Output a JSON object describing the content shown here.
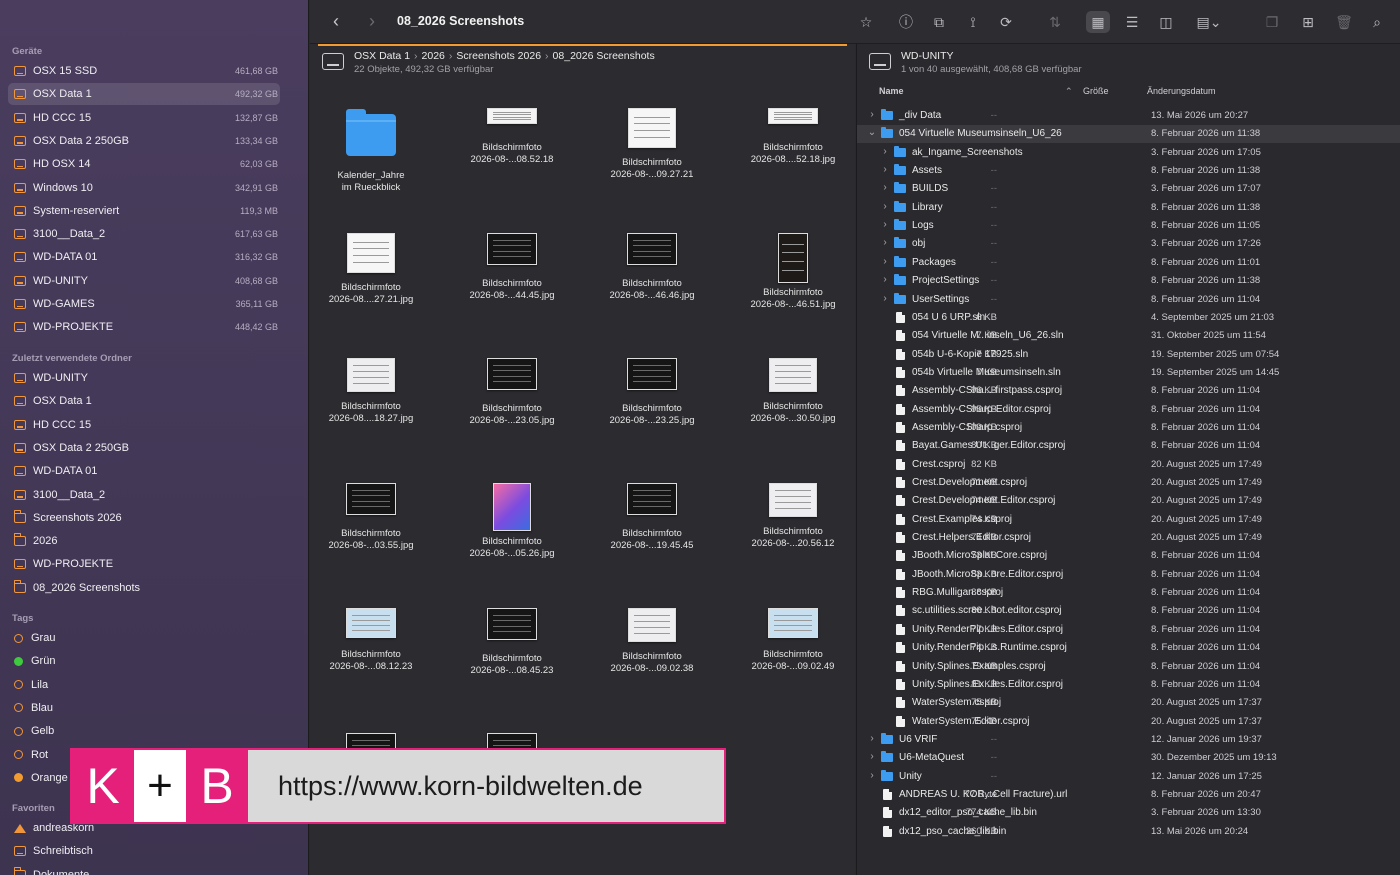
{
  "sidebar": {
    "devices_heading": "Geräte",
    "devices": [
      {
        "label": "OSX 15 SSD",
        "size": "461,68 GB"
      },
      {
        "label": "OSX Data 1",
        "size": "492,32 GB",
        "selected": true
      },
      {
        "label": "HD CCC 15",
        "size": "132,87 GB"
      },
      {
        "label": "OSX Data 2 250GB",
        "size": "133,34 GB"
      },
      {
        "label": "HD OSX 14",
        "size": "62,03 GB"
      },
      {
        "label": "Windows 10",
        "size": "342,91 GB"
      },
      {
        "label": "System-reserviert",
        "size": "119,3 MB"
      },
      {
        "label": "3100__Data_2",
        "size": "617,63 GB"
      },
      {
        "label": "WD-DATA 01",
        "size": "316,32 GB"
      },
      {
        "label": "WD-UNITY",
        "size": "408,68 GB"
      },
      {
        "label": "WD-GAMES",
        "size": "365,11 GB"
      },
      {
        "label": "WD-PROJEKTE",
        "size": "448,42 GB"
      }
    ],
    "recent_heading": "Zuletzt verwendete Ordner",
    "recent": [
      {
        "label": "WD-UNITY",
        "icon": "drive-icon"
      },
      {
        "label": "OSX Data 1",
        "icon": "drive-icon"
      },
      {
        "label": "HD CCC 15",
        "icon": "drive-icon"
      },
      {
        "label": "OSX Data 2 250GB",
        "icon": "drive-icon"
      },
      {
        "label": "WD-DATA 01",
        "icon": "drive-icon"
      },
      {
        "label": "3100__Data_2",
        "icon": "drive-icon"
      },
      {
        "label": "Screenshots 2026",
        "icon": "folder-icon"
      },
      {
        "label": "2026",
        "icon": "folder-icon"
      },
      {
        "label": "WD-PROJEKTE",
        "icon": "drive-icon"
      },
      {
        "label": "08_2026 Screenshots",
        "icon": "folder-icon"
      }
    ],
    "tags_heading": "Tags",
    "tags": [
      {
        "label": "Grau",
        "color": "empty"
      },
      {
        "label": "Grün",
        "color": "green"
      },
      {
        "label": "Lila",
        "color": "empty"
      },
      {
        "label": "Blau",
        "color": "empty"
      },
      {
        "label": "Gelb",
        "color": "empty"
      },
      {
        "label": "Rot",
        "color": "empty"
      },
      {
        "label": "Orange",
        "color": "orange"
      }
    ],
    "favorites_heading": "Favoriten",
    "favorites": [
      {
        "label": "andreaskorn",
        "icon": "home-icon"
      },
      {
        "label": "Schreibtisch",
        "icon": "drive-icon"
      },
      {
        "label": "Dokumente",
        "icon": "folder-icon"
      }
    ]
  },
  "toolbar": {
    "back": "‹",
    "forward": "›",
    "title": "08_2026 Screenshots",
    "icons": [
      {
        "name": "favorite-star-icon",
        "glyph": "☆",
        "on": false
      },
      {
        "name": "info-icon",
        "glyph": "ⓘ",
        "on": false
      },
      {
        "name": "group-icon",
        "glyph": "⧉",
        "on": false
      },
      {
        "name": "share-link-icon",
        "glyph": "⟟",
        "on": false
      },
      {
        "name": "sync-icon",
        "glyph": "⟳",
        "on": false
      },
      {
        "name": "swap-panes-icon",
        "glyph": "⇅",
        "on": false,
        "dim": true
      },
      {
        "name": "grid-view-icon",
        "glyph": "▦",
        "on": true
      },
      {
        "name": "list-view-icon",
        "glyph": "☰",
        "on": false
      },
      {
        "name": "column-view-icon",
        "glyph": "◫",
        "on": false
      },
      {
        "name": "gallery-view-icon",
        "glyph": "▤⌄",
        "on": false
      },
      {
        "name": "copy-icon",
        "glyph": "❐",
        "on": false,
        "dim": true
      },
      {
        "name": "new-folder-icon",
        "glyph": "⊞",
        "on": false
      },
      {
        "name": "trash-icon",
        "glyph": "🗑",
        "on": false,
        "dim": true
      },
      {
        "name": "search-icon",
        "glyph": "⌕",
        "on": false
      }
    ]
  },
  "left": {
    "path": [
      "OSX Data 1",
      "2026",
      "Screenshots 2026",
      "08_2026 Screenshots"
    ],
    "path_sep": "›",
    "status": "22 Objekte, 492,32 GB verfügbar",
    "items": [
      {
        "l1": "Kalender_Jahre",
        "l2": "im Rueckblick",
        "kind": "folder"
      },
      {
        "l1": "Bildschirmfoto",
        "l2": "2026-08-...08.52.18",
        "kind": "wide"
      },
      {
        "l1": "Bildschirmfoto",
        "l2": "2026-08-...09.27.21",
        "kind": "doc"
      },
      {
        "l1": "Bildschirmfoto",
        "l2": "2026-08....52.18.jpg",
        "kind": "wide"
      },
      {
        "l1": "Bildschirmfoto",
        "l2": "2026-08....27.21.jpg",
        "kind": "doc"
      },
      {
        "l1": "Bildschirmfoto",
        "l2": "2026-08-...44.45.jpg",
        "kind": "dark"
      },
      {
        "l1": "Bildschirmfoto",
        "l2": "2026-08-...46.46.jpg",
        "kind": "dark"
      },
      {
        "l1": "Bildschirmfoto",
        "l2": "2026-08-...46.51.jpg",
        "kind": "tall"
      },
      {
        "l1": "Bildschirmfoto",
        "l2": "2026-08....18.27.jpg",
        "kind": "light"
      },
      {
        "l1": "Bildschirmfoto",
        "l2": "2026-08-...23.05.jpg",
        "kind": "dark"
      },
      {
        "l1": "Bildschirmfoto",
        "l2": "2026-08-...23.25.jpg",
        "kind": "dark"
      },
      {
        "l1": "Bildschirmfoto",
        "l2": "2026-08-...30.50.jpg",
        "kind": "light"
      },
      {
        "l1": "Bildschirmfoto",
        "l2": "2026-08-...03.55.jpg",
        "kind": "dark"
      },
      {
        "l1": "Bildschirmfoto",
        "l2": "2026-08-...05.26.jpg",
        "kind": "grad"
      },
      {
        "l1": "Bildschirmfoto",
        "l2": "2026-08-...19.45.45",
        "kind": "dark"
      },
      {
        "l1": "Bildschirmfoto",
        "l2": "2026-08-...20.56.12",
        "kind": "light"
      },
      {
        "l1": "Bildschirmfoto",
        "l2": "2026-08-...08.12.23",
        "kind": "blue"
      },
      {
        "l1": "Bildschirmfoto",
        "l2": "2026-08-...08.45.23",
        "kind": "dark"
      },
      {
        "l1": "Bildschirmfoto",
        "l2": "2026-08-...09.02.38",
        "kind": "light"
      },
      {
        "l1": "Bildschirmfoto",
        "l2": "2026-08-...09.02.49",
        "kind": "blue"
      },
      {
        "l1": "",
        "l2": "",
        "kind": "dark"
      },
      {
        "l1": "",
        "l2": "",
        "kind": "dark"
      }
    ]
  },
  "right": {
    "title": "WD-UNITY",
    "status": "1 von 40 ausgewählt, 408,68 GB verfügbar",
    "col_name": "Name",
    "col_size": "Größe",
    "col_date": "Änderungsdatum",
    "rows": [
      {
        "depth": 0,
        "chev": "›",
        "icon": "folder",
        "name": "_div Data",
        "size": "--",
        "date": "13. Mai 2026 um 20:27"
      },
      {
        "depth": 0,
        "chev": "⌄",
        "icon": "folder",
        "name": "054 Virtuelle Museumsinseln_U6_26",
        "size": "--",
        "date": "8. Februar 2026 um 11:38",
        "selected": true
      },
      {
        "depth": 1,
        "chev": "›",
        "icon": "folder",
        "name": "ak_Ingame_Screenshots",
        "size": "--",
        "date": "3. Februar 2026 um 17:05"
      },
      {
        "depth": 1,
        "chev": "›",
        "icon": "folder",
        "name": "Assets",
        "size": "--",
        "date": "8. Februar 2026 um 11:38"
      },
      {
        "depth": 1,
        "chev": "›",
        "icon": "folder",
        "name": "BUILDS",
        "size": "--",
        "date": "3. Februar 2026 um 17:07"
      },
      {
        "depth": 1,
        "chev": "›",
        "icon": "folder",
        "name": "Library",
        "size": "--",
        "date": "8. Februar 2026 um 11:38"
      },
      {
        "depth": 1,
        "chev": "›",
        "icon": "folder",
        "name": "Logs",
        "size": "--",
        "date": "8. Februar 2026 um 11:05"
      },
      {
        "depth": 1,
        "chev": "›",
        "icon": "folder",
        "name": "obj",
        "size": "--",
        "date": "3. Februar 2026 um 17:26"
      },
      {
        "depth": 1,
        "chev": "›",
        "icon": "folder",
        "name": "Packages",
        "size": "--",
        "date": "8. Februar 2026 um 11:01"
      },
      {
        "depth": 1,
        "chev": "›",
        "icon": "folder",
        "name": "ProjectSettings",
        "size": "--",
        "date": "8. Februar 2026 um 11:38"
      },
      {
        "depth": 1,
        "chev": "›",
        "icon": "folder",
        "name": "UserSettings",
        "size": "--",
        "date": "8. Februar 2026 um 11:04"
      },
      {
        "depth": 1,
        "chev": "",
        "icon": "file",
        "name": "054 U 6 URP.sln",
        "size": "6 KB",
        "date": "4. September 2025 um 21:03"
      },
      {
        "depth": 1,
        "chev": "",
        "icon": "file",
        "name": "054 Virtuelle M...inseln_U6_26.sln",
        "size": "7 KB",
        "date": "31. Oktober 2025 um 11:54"
      },
      {
        "depth": 1,
        "chev": "",
        "icon": "file",
        "name": "054b U-6-Kopie 17925.sln",
        "size": "7 KB",
        "date": "19. September 2025 um 07:54"
      },
      {
        "depth": 1,
        "chev": "",
        "icon": "file",
        "name": "054b Virtuelle Museumsinseln.sln",
        "size": "7 KB",
        "date": "19. September 2025 um 14:45"
      },
      {
        "depth": 1,
        "chev": "",
        "icon": "file",
        "name": "Assembly-CSha...-firstpass.csproj",
        "size": "96 KB",
        "date": "8. Februar 2026 um 11:04"
      },
      {
        "depth": 1,
        "chev": "",
        "icon": "file",
        "name": "Assembly-CSharp-Editor.csproj",
        "size": "95 KB",
        "date": "8. Februar 2026 um 11:04"
      },
      {
        "depth": 1,
        "chev": "",
        "icon": "file",
        "name": "Assembly-CSharp.csproj",
        "size": "109 KB",
        "date": "8. Februar 2026 um 11:04"
      },
      {
        "depth": 1,
        "chev": "",
        "icon": "file",
        "name": "Bayat.Games.Ut...ger.Editor.csproj",
        "size": "80 KB",
        "date": "8. Februar 2026 um 11:04"
      },
      {
        "depth": 1,
        "chev": "",
        "icon": "file",
        "name": "Crest.csproj",
        "size": "82 KB",
        "date": "20. August 2025 um 17:49"
      },
      {
        "depth": 1,
        "chev": "",
        "icon": "file",
        "name": "Crest.Development.csproj",
        "size": "71 KB",
        "date": "20. August 2025 um 17:49"
      },
      {
        "depth": 1,
        "chev": "",
        "icon": "file",
        "name": "Crest.Development.Editor.csproj",
        "size": "74 KB",
        "date": "20. August 2025 um 17:49"
      },
      {
        "depth": 1,
        "chev": "",
        "icon": "file",
        "name": "Crest.Examples.csproj",
        "size": "74 KB",
        "date": "20. August 2025 um 17:49"
      },
      {
        "depth": 1,
        "chev": "",
        "icon": "file",
        "name": "Crest.Helpers.Editor.csproj",
        "size": "74 KB",
        "date": "20. August 2025 um 17:49"
      },
      {
        "depth": 1,
        "chev": "",
        "icon": "file",
        "name": "JBooth.MicroSplat.Core.csproj",
        "size": "73 KB",
        "date": "8. Februar 2026 um 11:04"
      },
      {
        "depth": 1,
        "chev": "",
        "icon": "file",
        "name": "JBooth.MicroSp...ore.Editor.csproj",
        "size": "83 KB",
        "date": "8. Februar 2026 um 11:04"
      },
      {
        "depth": 1,
        "chev": "",
        "icon": "file",
        "name": "RBG.Mulligan.csproj",
        "size": "88 KB",
        "date": "8. Februar 2026 um 11:04"
      },
      {
        "depth": 1,
        "chev": "",
        "icon": "file",
        "name": "sc.utilities.scree...hot.editor.csproj",
        "size": "80 KB",
        "date": "8. Februar 2026 um 11:04"
      },
      {
        "depth": 1,
        "chev": "",
        "icon": "file",
        "name": "Unity.RenderPip...les.Editor.csproj",
        "size": "77 KB",
        "date": "8. Februar 2026 um 11:04"
      },
      {
        "depth": 1,
        "chev": "",
        "icon": "file",
        "name": "Unity.RenderPip...s.Runtime.csproj",
        "size": "74 KB",
        "date": "8. Februar 2026 um 11:04"
      },
      {
        "depth": 1,
        "chev": "",
        "icon": "file",
        "name": "Unity.Splines.Examples.csproj",
        "size": "79 KB",
        "date": "8. Februar 2026 um 11:04"
      },
      {
        "depth": 1,
        "chev": "",
        "icon": "file",
        "name": "Unity.Splines.Ex...les.Editor.csproj",
        "size": "81 KB",
        "date": "8. Februar 2026 um 11:04"
      },
      {
        "depth": 1,
        "chev": "",
        "icon": "file",
        "name": "WaterSystem.csproj",
        "size": "75 KB",
        "date": "20. August 2025 um 17:37"
      },
      {
        "depth": 1,
        "chev": "",
        "icon": "file",
        "name": "WaterSystem.Editor.csproj",
        "size": "75 KB",
        "date": "20. August 2025 um 17:37"
      },
      {
        "depth": 0,
        "chev": "›",
        "icon": "folder",
        "name": "U6 VRIF",
        "size": "--",
        "date": "12. Januar 2026 um 19:37"
      },
      {
        "depth": 0,
        "chev": "›",
        "icon": "folder",
        "name": "U6-MetaQuest",
        "size": "--",
        "date": "30. Dezember 2025 um 19:13"
      },
      {
        "depth": 0,
        "chev": "›",
        "icon": "folder",
        "name": "Unity",
        "size": "--",
        "date": "12. Januar 2026 um 17:25"
      },
      {
        "depth": 0,
        "chev": "",
        "icon": "file",
        "name": "ANDREAS U. KOR...Cell Fracture).url",
        "size": "77 Byte",
        "date": "8. Februar 2026 um 20:47"
      },
      {
        "depth": 0,
        "chev": "",
        "icon": "file",
        "name": "dx12_editor_pso_cache_lib.bin",
        "size": "774 KB",
        "date": "3. Februar 2026 um 13:30"
      },
      {
        "depth": 0,
        "chev": "",
        "icon": "file",
        "name": "dx12_pso_cache_lib.bin",
        "size": "260 KB",
        "date": "13. Mai 2026 um 20:24"
      }
    ]
  },
  "banner": {
    "logo_k": "K",
    "logo_plus": "+",
    "logo_b": "B",
    "url": "https://www.korn-bildwelten.de"
  }
}
